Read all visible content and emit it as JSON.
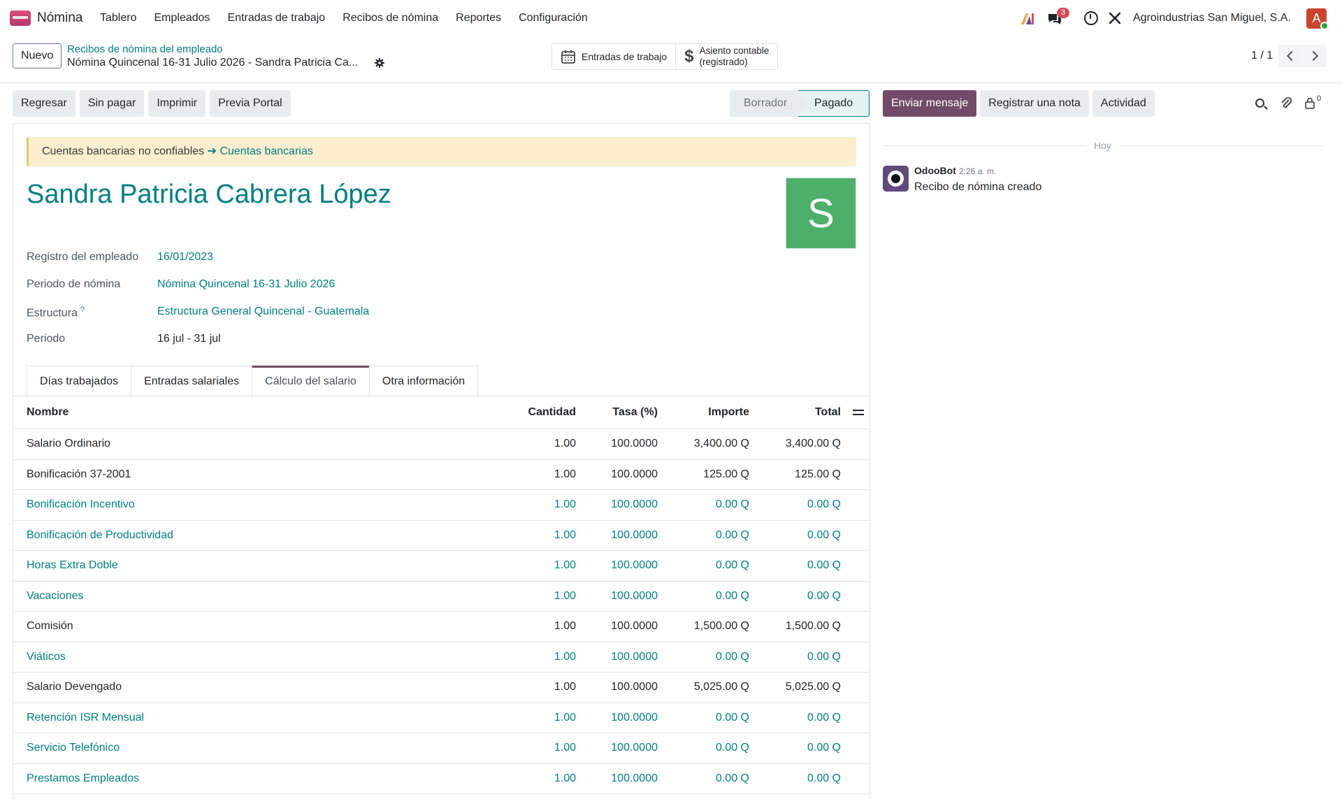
{
  "navbar": {
    "app_name": "Nómina",
    "menu": [
      "Tablero",
      "Empleados",
      "Entradas de trabajo",
      "Recibos de nómina",
      "Reportes",
      "Configuración"
    ],
    "notifications_count": "3",
    "company": "Agroindustrias San Miguel, S.A.",
    "user_initial": "A"
  },
  "control": {
    "new_label": "Nuevo",
    "breadcrumb_parent": "Recibos de nómina del empleado",
    "breadcrumb_current": "Nómina Quincenal 16-31 Julio 2026 - Sandra Patricia Ca...",
    "smart_work_entries": "Entradas de trabajo",
    "smart_journal_line1": "Asiento contable",
    "smart_journal_line2": "(registrado)",
    "pager": "1 / 1"
  },
  "status_buttons": [
    "Regresar",
    "Sin pagar",
    "Imprimir",
    "Previa Portal"
  ],
  "stages": {
    "draft": "Borrador",
    "paid": "Pagado"
  },
  "form": {
    "alert_text": "Cuentas bancarias no confiables ",
    "alert_link": "➔ Cuentas bancarias",
    "employee_name": "Sandra Patricia Cabrera López",
    "avatar_initial": "S",
    "fields": {
      "registro_label": "Registro del empleado",
      "registro_value": "16/01/2023",
      "periodo_nomina_label": "Periodo de nómina",
      "periodo_nomina_value": "Nómina Quincenal 16-31 Julio 2026",
      "estructura_label": "Estructura",
      "estructura_help": "?",
      "estructura_value": "Estructura General Quincenal - Guatemala",
      "periodo_label": "Periodo",
      "periodo_value": "16 jul - 31 jul"
    },
    "tabs": [
      "Días trabajados",
      "Entradas salariales",
      "Cálculo del salario",
      "Otra información"
    ],
    "active_tab": "Cálculo del salario"
  },
  "table": {
    "headers": {
      "name": "Nombre",
      "qty": "Cantidad",
      "rate": "Tasa (%)",
      "amount": "Importe",
      "total": "Total"
    },
    "rows": [
      {
        "name": "Salario Ordinario",
        "qty": "1.00",
        "rate": "100.0000",
        "amount": "3,400.00 Q",
        "total": "3,400.00 Q",
        "link": false
      },
      {
        "name": "Bonificación 37-2001",
        "qty": "1.00",
        "rate": "100.0000",
        "amount": "125.00 Q",
        "total": "125.00 Q",
        "link": false
      },
      {
        "name": "Bonificación Incentivo",
        "qty": "1.00",
        "rate": "100.0000",
        "amount": "0.00 Q",
        "total": "0.00 Q",
        "link": true
      },
      {
        "name": "Bonificación de Productividad",
        "qty": "1.00",
        "rate": "100.0000",
        "amount": "0.00 Q",
        "total": "0.00 Q",
        "link": true
      },
      {
        "name": "Horas Extra Doble",
        "qty": "1.00",
        "rate": "100.0000",
        "amount": "0.00 Q",
        "total": "0.00 Q",
        "link": true
      },
      {
        "name": "Vacaciones",
        "qty": "1.00",
        "rate": "100.0000",
        "amount": "0.00 Q",
        "total": "0.00 Q",
        "link": true
      },
      {
        "name": "Comisión",
        "qty": "1.00",
        "rate": "100.0000",
        "amount": "1,500.00 Q",
        "total": "1,500.00 Q",
        "link": false
      },
      {
        "name": "Viáticos",
        "qty": "1.00",
        "rate": "100.0000",
        "amount": "0.00 Q",
        "total": "0.00 Q",
        "link": true
      },
      {
        "name": "Salario Devengado",
        "qty": "1.00",
        "rate": "100.0000",
        "amount": "5,025.00 Q",
        "total": "5,025.00 Q",
        "link": false
      },
      {
        "name": "Retención ISR Mensual",
        "qty": "1.00",
        "rate": "100.0000",
        "amount": "0.00 Q",
        "total": "0.00 Q",
        "link": true
      },
      {
        "name": "Servicio Telefónico",
        "qty": "1.00",
        "rate": "100.0000",
        "amount": "0.00 Q",
        "total": "0.00 Q",
        "link": true
      },
      {
        "name": "Prestamos Empleados",
        "qty": "1.00",
        "rate": "100.0000",
        "amount": "0.00 Q",
        "total": "0.00 Q",
        "link": true
      }
    ]
  },
  "chatter": {
    "send_message": "Enviar mensaje",
    "log_note": "Registrar una nota",
    "activity": "Actividad",
    "followers_count": "0",
    "date_separator": "Hoy",
    "message_author": "OdooBot",
    "message_time": "2:26 a. m.",
    "message_body": "Recibo de nómina creado"
  },
  "colors": {
    "primary": "#714b67",
    "link": "#017e84",
    "alert_bg": "#fcefcf",
    "avatar": "#4caf6a"
  }
}
